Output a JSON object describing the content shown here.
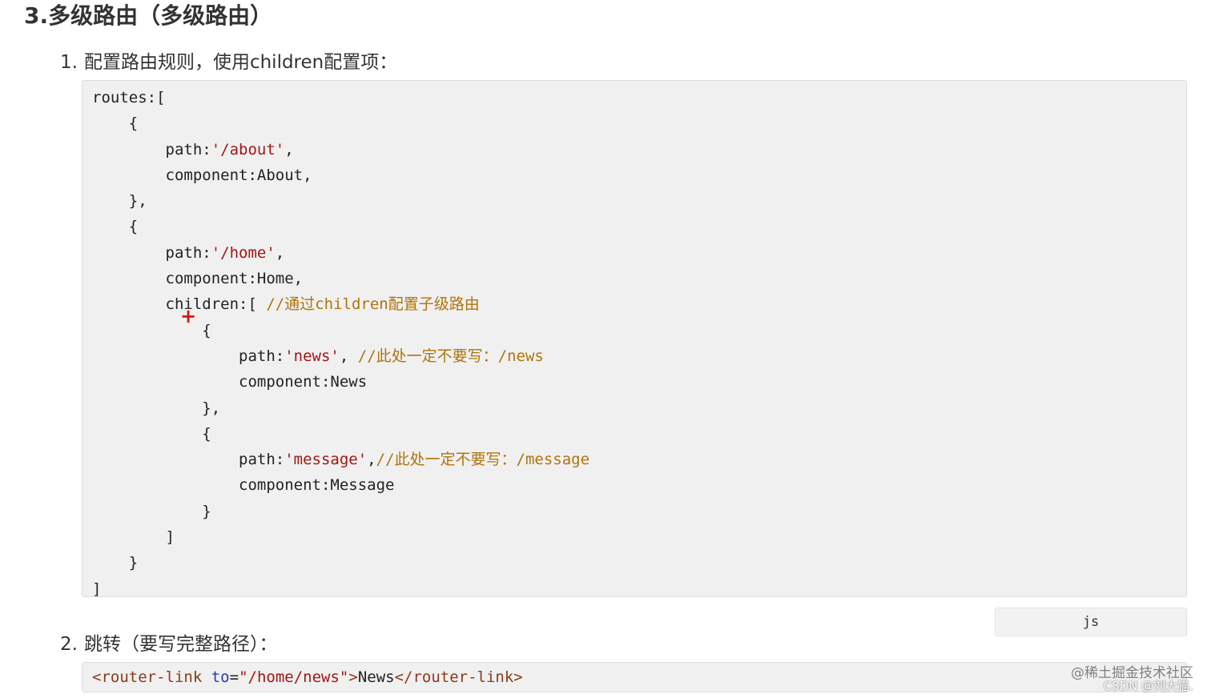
{
  "heading": "3.多级路由（多级路由）",
  "steps": [
    {
      "number": "1.",
      "text": "配置路由规则，使用children配置项："
    },
    {
      "number": "2.",
      "text": "跳转（要写完整路径）："
    }
  ],
  "code_block": {
    "language": "js",
    "lines": [
      [
        {
          "t": "plain",
          "v": "routes:["
        }
      ],
      [
        {
          "t": "plain",
          "v": "    {"
        }
      ],
      [
        {
          "t": "plain",
          "v": "        path:"
        },
        {
          "t": "str",
          "v": "'/about'"
        },
        {
          "t": "plain",
          "v": ","
        }
      ],
      [
        {
          "t": "plain",
          "v": "        component:About,"
        }
      ],
      [
        {
          "t": "plain",
          "v": "    },"
        }
      ],
      [
        {
          "t": "plain",
          "v": "    {"
        }
      ],
      [
        {
          "t": "plain",
          "v": "        path:"
        },
        {
          "t": "str",
          "v": "'/home'"
        },
        {
          "t": "plain",
          "v": ","
        }
      ],
      [
        {
          "t": "plain",
          "v": "        component:Home,"
        }
      ],
      [
        {
          "t": "plain",
          "v": "        children:[ "
        },
        {
          "t": "comment",
          "v": "//通过children配置子级路由"
        }
      ],
      [
        {
          "t": "plain",
          "v": "            {"
        }
      ],
      [
        {
          "t": "plain",
          "v": "                path:"
        },
        {
          "t": "str",
          "v": "'news'"
        },
        {
          "t": "plain",
          "v": ", "
        },
        {
          "t": "comment",
          "v": "//此处一定不要写：/news"
        }
      ],
      [
        {
          "t": "plain",
          "v": "                component:News"
        }
      ],
      [
        {
          "t": "plain",
          "v": "            },"
        }
      ],
      [
        {
          "t": "plain",
          "v": "            {"
        }
      ],
      [
        {
          "t": "plain",
          "v": "                path:"
        },
        {
          "t": "str",
          "v": "'message'"
        },
        {
          "t": "plain",
          "v": ","
        },
        {
          "t": "comment",
          "v": "//此处一定不要写：/message"
        }
      ],
      [
        {
          "t": "plain",
          "v": "                component:Message"
        }
      ],
      [
        {
          "t": "plain",
          "v": "            }"
        }
      ],
      [
        {
          "t": "plain",
          "v": "        ]"
        }
      ],
      [
        {
          "t": "plain",
          "v": "    }"
        }
      ],
      [
        {
          "t": "plain",
          "v": "]"
        }
      ]
    ]
  },
  "added_marker": "+",
  "code_inline": [
    {
      "t": "tag",
      "v": "<router-link"
    },
    {
      "t": "plain",
      "v": " "
    },
    {
      "t": "attr",
      "v": "to"
    },
    {
      "t": "plain",
      "v": "="
    },
    {
      "t": "str",
      "v": "\"/home/news\""
    },
    {
      "t": "tag",
      "v": ">"
    },
    {
      "t": "plain",
      "v": "News"
    },
    {
      "t": "tag",
      "v": "</router-link>"
    }
  ],
  "watermark": {
    "line1": "@稀土掘金技术社区",
    "line2": "CSDN @刘大猫."
  },
  "colors": {
    "string": "#a31515",
    "comment": "#b0740c",
    "tag": "#8b3a1a",
    "attr": "#1f3fb0",
    "marker": "#dd1111",
    "code_bg": "#f0f0f0"
  }
}
